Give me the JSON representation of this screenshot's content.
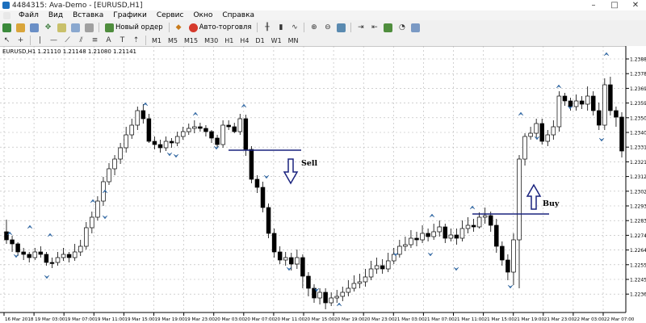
{
  "window": {
    "title": "4484315: Ava-Demo - [EURUSD,H1]",
    "minimize": "–",
    "maximize": "□",
    "close": "✕"
  },
  "menu": [
    "Файл",
    "Вид",
    "Вставка",
    "Графики",
    "Сервис",
    "Окно",
    "Справка"
  ],
  "toolbar": {
    "new_order": "Новый ордер",
    "autotrading": "Авто-торговля"
  },
  "timeframes": [
    "M1",
    "M5",
    "M15",
    "M30",
    "H1",
    "H4",
    "D1",
    "W1",
    "MN"
  ],
  "chart": {
    "header": "EURUSD,H1  1.21110 1.21148 1.21080 1.21141",
    "signal_sell": "Sell",
    "signal_buy": "Buy",
    "y_labels": [
      "1.23880",
      "1.23785",
      "1.23690",
      "1.23595",
      "1.23500",
      "1.23405",
      "1.23310",
      "1.23215",
      "1.23120",
      "1.23025",
      "1.22930",
      "1.22835",
      "1.22740",
      "1.22645",
      "1.22550",
      "1.22455",
      "1.22360"
    ],
    "x_labels": [
      "16 Mar 2018",
      "19 Mar 03:00",
      "19 Mar 07:00",
      "19 Mar 11:00",
      "19 Mar 15:00",
      "19 Mar 19:00",
      "19 Mar 23:00",
      "20 Mar 03:00",
      "20 Mar 07:00",
      "20 Mar 11:00",
      "20 Mar 15:00",
      "20 Mar 19:00",
      "20 Mar 23:00",
      "21 Mar 03:00",
      "21 Mar 07:00",
      "21 Mar 11:00",
      "21 Mar 15:00",
      "21 Mar 19:00",
      "21 Mar 23:00",
      "22 Mar 03:00",
      "22 Mar 07:00"
    ]
  },
  "colors": {
    "bull": "#ffffff",
    "bear": "#000000",
    "line": "#1a237e",
    "arrow": "#2f6fb0"
  }
}
